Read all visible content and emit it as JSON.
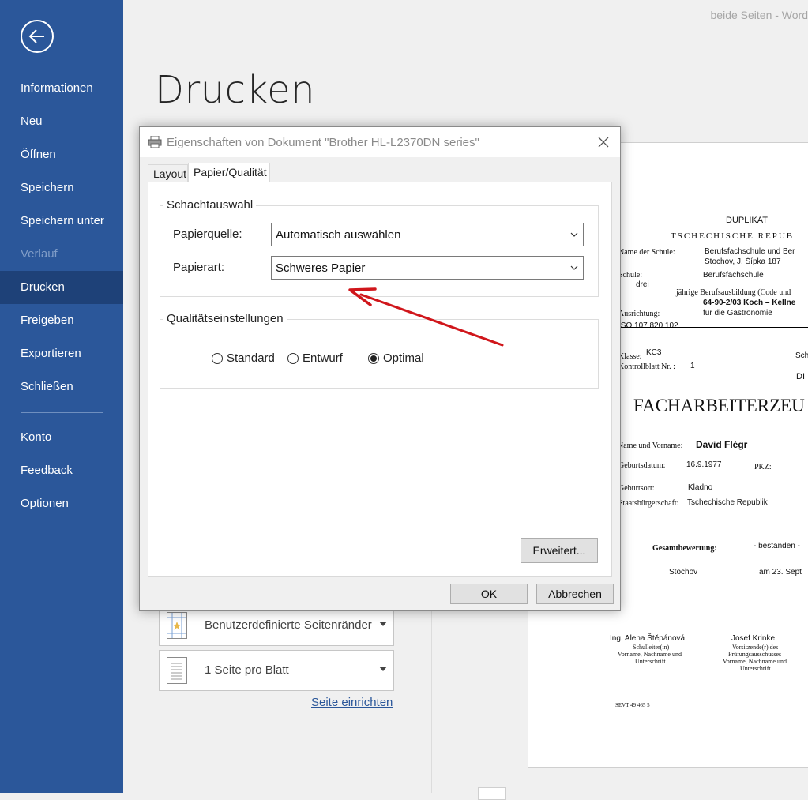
{
  "sidebar": {
    "items": [
      {
        "label": "Informationen"
      },
      {
        "label": "Neu"
      },
      {
        "label": "Öffnen"
      },
      {
        "label": "Speichern"
      },
      {
        "label": "Speichern unter"
      },
      {
        "label": "Verlauf"
      },
      {
        "label": "Drucken"
      },
      {
        "label": "Freigeben"
      },
      {
        "label": "Exportieren"
      },
      {
        "label": "Schließen"
      },
      {
        "label": "Konto"
      },
      {
        "label": "Feedback"
      },
      {
        "label": "Optionen"
      }
    ],
    "active_item": "Drucken",
    "disabled_item": "Verlauf",
    "accent_color": "#2b579a"
  },
  "window": {
    "title": "beide Seiten  -  Word"
  },
  "main": {
    "page_title": "Drucken",
    "settings": {
      "margins_label": "Benutzerdefinierte Seitenränder",
      "pages_per_sheet_label": "1 Seite pro Blatt",
      "page_setup_link": "Seite einrichten"
    }
  },
  "dialog": {
    "title": "Eigenschaften von Dokument \"Brother HL-L2370DN series\"",
    "tabs": [
      {
        "label": "Layout"
      },
      {
        "label": "Papier/Qualität"
      }
    ],
    "active_tab": "Papier/Qualität",
    "tray_group": {
      "title": "Schachtauswahl",
      "source_label": "Papierquelle:",
      "source_value": "Automatisch auswählen",
      "media_label": "Papierart:",
      "media_value": "Schweres Papier"
    },
    "quality_group": {
      "title": "Qualitätseinstellungen",
      "options": [
        {
          "label": "Standard",
          "selected": false
        },
        {
          "label": "Entwurf",
          "selected": false
        },
        {
          "label": "Optimal",
          "selected": true
        }
      ]
    },
    "advanced_button": "Erweitert...",
    "ok_button": "OK",
    "cancel_button": "Abbrechen",
    "annotation_arrow_color": "#d0161b"
  },
  "preview": {
    "lines": [
      "DUPLIKAT",
      "TSCHECHISCHE REPUB",
      "Name der Schule:",
      "Berufsfachschule und Ber",
      "Stochov, J. Šípka 187",
      "Schule:",
      "Berufsfachschule",
      "drei",
      "jährige Berufsausbildung (Code und",
      "64-90-2/03 Koch – Kellne",
      "Ausrichtung:",
      "für die Gastronomie",
      "ISO   107 820 102",
      "Klasse:",
      "KC3",
      "Sch",
      "Kontrollblatt Nr. :",
      "1",
      "DI",
      "FACHARBEITERZEU",
      "Name und Vorname:",
      "David Flégr",
      "Geburtsdatum:",
      "16.9.1977",
      "PKZ:",
      "Geburtsort:",
      "Kladno",
      "Staatsbürgerschaft:",
      "Tschechische Republik",
      "Gesamtbewertung:",
      "- bestanden -",
      "Stochov",
      "am 23. Sept",
      "Ing. Alena Štěpánová",
      "Schulleiter(in)",
      "Vorname, Nachname und",
      "Unterschrift",
      "Josef Krinke",
      "Vorsitzende(r) des",
      "Prüfungsausschusses",
      "Vorname, Nachname und",
      "Unterschrift",
      "SEVT 49 465 5"
    ]
  }
}
